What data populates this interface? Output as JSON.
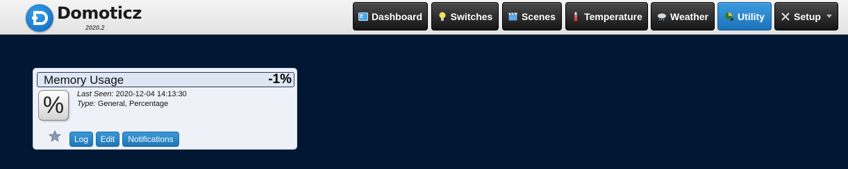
{
  "app": {
    "name": "Domoticz",
    "version": "2020.2"
  },
  "nav": [
    {
      "label": "Dashboard",
      "icon": "dashboard-icon"
    },
    {
      "label": "Switches",
      "icon": "lightbulb-icon"
    },
    {
      "label": "Scenes",
      "icon": "clapperboard-icon"
    },
    {
      "label": "Temperature",
      "icon": "thermometer-icon"
    },
    {
      "label": "Weather",
      "icon": "weather-icon"
    },
    {
      "label": "Utility",
      "icon": "utility-icon",
      "active": true
    },
    {
      "label": "Setup",
      "icon": "tools-icon"
    }
  ],
  "device": {
    "name": "Memory Usage",
    "value": "-1%",
    "icon_glyph": "%",
    "last_seen_label": "Last Seen:",
    "last_seen": "2020-12-04 14:13:30",
    "type_label": "Type:",
    "type": "General, Percentage",
    "buttons": {
      "log": "Log",
      "edit": "Edit",
      "notifications": "Notifications"
    }
  },
  "colors": {
    "background": "#011733",
    "accent": "#2386c8",
    "nav_dark": "#1f1f1f"
  }
}
